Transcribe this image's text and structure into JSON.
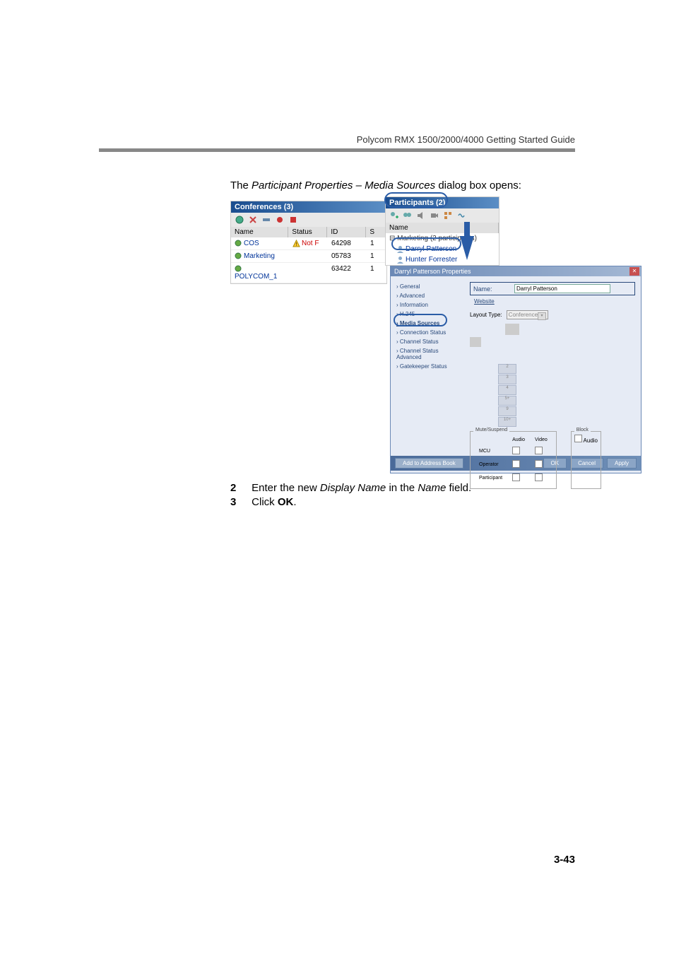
{
  "header": {
    "doc_title": "Polycom RMX 1500/2000/4000 Getting Started Guide"
  },
  "intro": {
    "prefix": "The ",
    "italic": "Participant Properties – Media Sources",
    "suffix": " dialog box opens:"
  },
  "conferences": {
    "title": "Conferences (3)",
    "columns": {
      "name": "Name",
      "status": "Status",
      "id": "ID",
      "s": "S"
    },
    "rows": [
      {
        "name": "COS",
        "status": "Not F",
        "status_icon": "!",
        "id": "64298",
        "s": "1"
      },
      {
        "name": "Marketing",
        "status": "",
        "id": "05783",
        "s": "1"
      },
      {
        "name": "POLYCOM_1",
        "status": "",
        "id": "63422",
        "s": "1"
      }
    ]
  },
  "participants": {
    "title": "Participants (2)",
    "column_name": "Name",
    "group": "Marketing (2 participants)",
    "items": [
      "Darryl Patterson",
      "Hunter Forrester"
    ]
  },
  "dialog": {
    "title": "Darryl Patterson Properties",
    "nav": [
      {
        "label": "General"
      },
      {
        "label": "Advanced"
      },
      {
        "label": "Information"
      },
      {
        "label": "H.245"
      },
      {
        "label": "Media Sources"
      },
      {
        "label": "Connection Status"
      },
      {
        "label": "Channel Status"
      },
      {
        "label": "Channel Status Advanced"
      },
      {
        "label": "Gatekeeper Status"
      }
    ],
    "main": {
      "name_label": "Name:",
      "name_value": "Darryl Patterson",
      "website": "Website",
      "layout_label": "Layout Type:",
      "layout_value": "Conference",
      "sd": [
        "2",
        "3",
        "4",
        "5+",
        "9",
        "10+"
      ],
      "mute_title": "Mute/Suspend",
      "mute_cols": [
        "Audio",
        "Video"
      ],
      "mute_rows": [
        "MCU",
        "Operator",
        "Participant"
      ],
      "block_title": "Block",
      "block_audio": "Audio"
    },
    "buttons": {
      "address": "Add to Address Book",
      "ok": "OK",
      "cancel": "Cancel",
      "apply": "Apply"
    }
  },
  "steps": {
    "s2_num": "2",
    "s2_pre": "Enter the new ",
    "s2_it1": "Display Name",
    "s2_mid": " in the ",
    "s2_it2": "Name",
    "s2_post": " field.",
    "s3_num": "3",
    "s3_pre": "Click ",
    "s3_bold": "OK",
    "s3_post": "."
  },
  "page_num": "3-43"
}
